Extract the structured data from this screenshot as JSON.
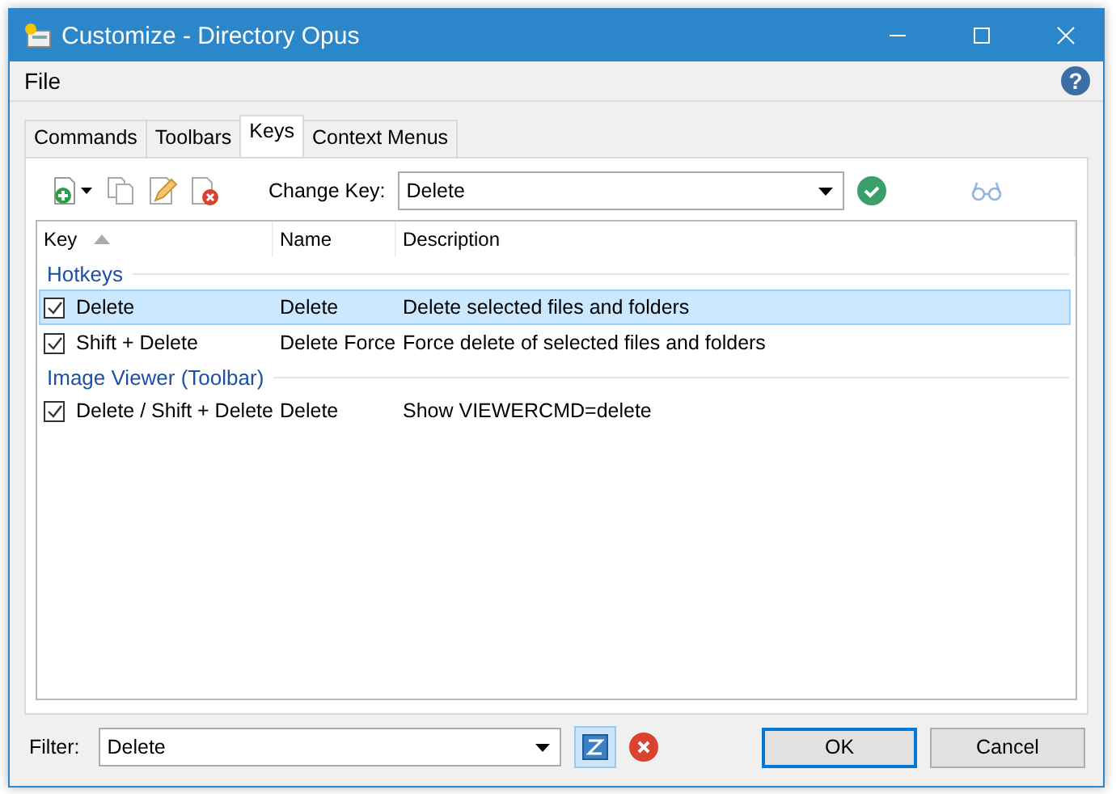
{
  "window": {
    "title": "Customize - Directory Opus"
  },
  "menu": [
    {
      "label": "File"
    }
  ],
  "help": "?",
  "tabs": [
    {
      "label": "Commands",
      "selected": false
    },
    {
      "label": "Toolbars",
      "selected": false
    },
    {
      "label": "Keys",
      "selected": true
    },
    {
      "label": "Context Menus",
      "selected": false
    }
  ],
  "toolbar": {
    "change_key_label": "Change Key:",
    "change_key_value": "Delete"
  },
  "table": {
    "columns": [
      "Key",
      "Name",
      "Description"
    ],
    "groups": [
      {
        "title": "Hotkeys",
        "rows": [
          {
            "key": "Delete",
            "name": "Delete",
            "description": "Delete selected files and folders",
            "checked": true,
            "selected": true
          },
          {
            "key": "Shift + Delete",
            "name": "Delete Force",
            "description": "Force delete of selected files and folders",
            "checked": true,
            "selected": false
          }
        ]
      },
      {
        "title": "Image Viewer (Toolbar)",
        "rows": [
          {
            "key": "Delete / Shift + Delete",
            "name": "Delete",
            "description": "Show VIEWERCMD=delete",
            "checked": true,
            "selected": false
          }
        ]
      }
    ]
  },
  "filter": {
    "label": "Filter:",
    "value": "Delete",
    "toggle_on": true
  },
  "buttons": [
    {
      "label": "OK",
      "default": true
    },
    {
      "label": "Cancel",
      "default": false
    }
  ]
}
